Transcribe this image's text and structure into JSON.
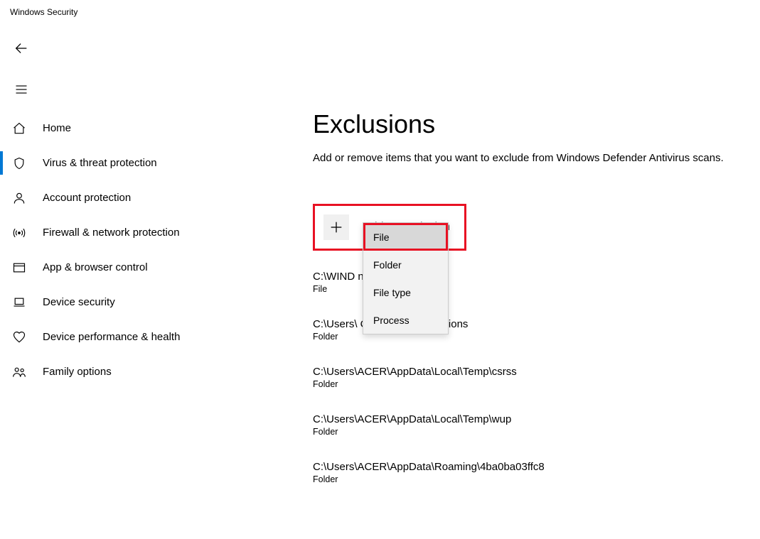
{
  "app_title": "Windows Security",
  "page": {
    "title": "Exclusions",
    "description": "Add or remove items that you want to exclude from Windows Defender Antivirus scans.",
    "add_label": "Add an exclusion"
  },
  "sidebar": {
    "items": [
      {
        "id": "home",
        "label": "Home"
      },
      {
        "id": "virus",
        "label": "Virus & threat protection"
      },
      {
        "id": "account",
        "label": "Account protection"
      },
      {
        "id": "firewall",
        "label": "Firewall & network protection"
      },
      {
        "id": "appbrowser",
        "label": "App & browser control"
      },
      {
        "id": "device",
        "label": "Device security"
      },
      {
        "id": "performance",
        "label": "Device performance & health"
      },
      {
        "id": "family",
        "label": "Family options"
      }
    ]
  },
  "dropdown": {
    "items": [
      {
        "label": "File"
      },
      {
        "label": "Folder"
      },
      {
        "label": "File type"
      },
      {
        "label": "Process"
      }
    ]
  },
  "exclusions": [
    {
      "path": "C:\\WIND                               nder.exe",
      "type": "File"
    },
    {
      "path": "C:\\Users\\                              Celemony\\Separations",
      "type": "Folder"
    },
    {
      "path": "C:\\Users\\ACER\\AppData\\Local\\Temp\\csrss",
      "type": "Folder"
    },
    {
      "path": "C:\\Users\\ACER\\AppData\\Local\\Temp\\wup",
      "type": "Folder"
    },
    {
      "path": "C:\\Users\\ACER\\AppData\\Roaming\\4ba0ba03ffc8",
      "type": "Folder"
    }
  ]
}
